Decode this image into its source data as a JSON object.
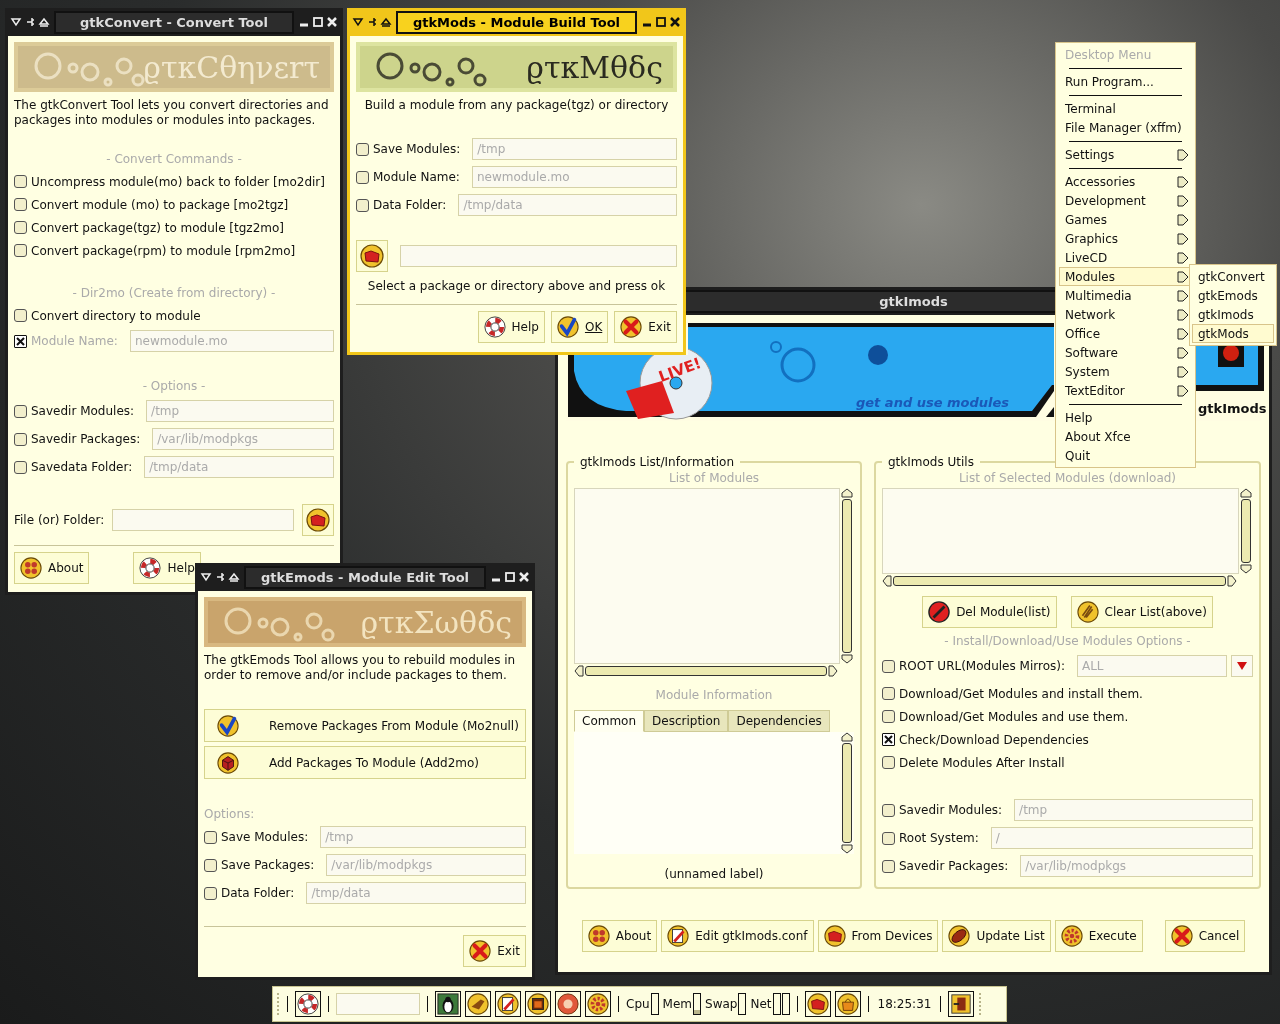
{
  "convert_window": {
    "title": "gtkConvert - Convert Tool",
    "active": false,
    "logo": "ϱτκCθηνεrτ",
    "description": "The gtkConvert Tool lets you convert directories and packages into modules or modules into packages.",
    "sections": [
      {
        "heading": "- Convert Commands -",
        "rows": [
          {
            "kind": "check",
            "label": "Uncompress module(mo) back to folder [mo2dir]",
            "checked": false,
            "disabled": false
          },
          {
            "kind": "check",
            "label": "Convert module (mo) to package [mo2tgz]",
            "checked": false,
            "disabled": false
          },
          {
            "kind": "check",
            "label": "Convert package(tgz) to module [tgz2mo]",
            "checked": false,
            "disabled": false
          },
          {
            "kind": "check",
            "label": "Convert package(rpm) to module [rpm2mo]",
            "checked": false,
            "disabled": false
          }
        ]
      },
      {
        "heading": "- Dir2mo (Create from directory) -",
        "rows": [
          {
            "kind": "check",
            "label": "Convert directory to module",
            "checked": false,
            "disabled": false
          },
          {
            "kind": "field",
            "label": "Module Name:",
            "checked": true,
            "disabled": true,
            "placeholder": "newmodule.mo"
          }
        ]
      },
      {
        "heading": "- Options -",
        "rows": [
          {
            "kind": "field",
            "label": "Savedir Modules:",
            "checked": false,
            "disabled": false,
            "placeholder": "/tmp"
          },
          {
            "kind": "field",
            "label": "Savedir Packages:",
            "checked": false,
            "disabled": false,
            "placeholder": "/var/lib/modpkgs"
          },
          {
            "kind": "field",
            "label": "Savedata Folder:",
            "checked": false,
            "disabled": false,
            "placeholder": "/tmp/data"
          }
        ]
      }
    ],
    "file_label": "File (or) Folder:",
    "buttons": [
      {
        "kind": "about",
        "label": "About"
      },
      {
        "kind": "help",
        "label": "Help"
      }
    ]
  },
  "mods_window": {
    "title": "gtkMods - Module Build Tool",
    "active": true,
    "logo": "ϱτκMθδς",
    "description": "Build a module from any package(tgz) or directory",
    "rows": [
      {
        "kind": "field",
        "label": "Save Modules:",
        "checked": false,
        "placeholder": "/tmp"
      },
      {
        "kind": "field",
        "label": "Module Name:",
        "checked": false,
        "placeholder": "newmodule.mo"
      },
      {
        "kind": "field",
        "label": "Data Folder:",
        "checked": false,
        "placeholder": "/tmp/data"
      }
    ],
    "status": "Select a package or directory above and press ok",
    "buttons": [
      {
        "kind": "help",
        "label": "Help"
      },
      {
        "kind": "ok",
        "label": "OK"
      },
      {
        "kind": "exit",
        "label": "Exit"
      }
    ]
  },
  "desktop_menu": {
    "items": [
      {
        "kind": "header",
        "label": "Desktop Menu"
      },
      {
        "kind": "separator"
      },
      {
        "kind": "item",
        "label": "Run Program...",
        "selected": false
      },
      {
        "kind": "separator"
      },
      {
        "kind": "item",
        "label": "Terminal",
        "selected": false
      },
      {
        "kind": "item",
        "label": "File Manager (xffm)",
        "selected": false
      },
      {
        "kind": "separator"
      },
      {
        "kind": "submenu",
        "label": "Settings",
        "selected": false
      },
      {
        "kind": "separator"
      },
      {
        "kind": "submenu",
        "label": "Accessories",
        "selected": false
      },
      {
        "kind": "submenu",
        "label": "Development",
        "selected": false
      },
      {
        "kind": "submenu",
        "label": "Games",
        "selected": false
      },
      {
        "kind": "submenu",
        "label": "Graphics",
        "selected": false
      },
      {
        "kind": "submenu",
        "label": "LiveCD",
        "selected": false
      },
      {
        "kind": "submenu",
        "label": "Modules",
        "selected": true,
        "items": [
          {
            "label": "gtkConvert",
            "selected": false
          },
          {
            "label": "gtkEmods",
            "selected": false
          },
          {
            "label": "gtkImods",
            "selected": false
          },
          {
            "label": "gtkMods",
            "selected": true
          }
        ]
      },
      {
        "kind": "submenu",
        "label": "Multimedia",
        "selected": false
      },
      {
        "kind": "submenu",
        "label": "Network",
        "selected": false
      },
      {
        "kind": "submenu",
        "label": "Office",
        "selected": false
      },
      {
        "kind": "submenu",
        "label": "Software",
        "selected": false
      },
      {
        "kind": "submenu",
        "label": "System",
        "selected": false
      },
      {
        "kind": "submenu",
        "label": "TextEditor",
        "selected": false
      },
      {
        "kind": "separator"
      },
      {
        "kind": "item",
        "label": "Help",
        "selected": false
      },
      {
        "kind": "item",
        "label": "About Xfce",
        "selected": false
      },
      {
        "kind": "item",
        "label": "Quit",
        "selected": false
      }
    ]
  },
  "imods_window": {
    "title": "gtkImods",
    "active": false,
    "banner": {
      "badge": "LIVE!",
      "tagline": "get and use modules",
      "logo": "gtkImods"
    },
    "list_panel": {
      "title": "gtkImods List/Information",
      "list_heading": "List of Modules",
      "info_heading": "Module Information",
      "tabs": [
        {
          "label": "Common",
          "selected": true
        },
        {
          "label": "Description",
          "selected": false
        },
        {
          "label": "Dependencies",
          "selected": false
        }
      ],
      "footer": "(unnamed label)"
    },
    "utils_panel": {
      "title": "gtkImods Utils",
      "list_heading": "List of Selected Modules (download)",
      "buttons": [
        {
          "kind": "delete",
          "label": "Del Module(list)"
        },
        {
          "kind": "clear",
          "label": "Clear List(above)"
        }
      ],
      "options_heading": "- Install/Download/Use Modules Options -",
      "rows": [
        {
          "kind": "combo",
          "label": "ROOT URL(Modules Mirros):",
          "checked": false,
          "placeholder": "ALL"
        },
        {
          "kind": "check",
          "label": "Download/Get Modules and install them.",
          "checked": false
        },
        {
          "kind": "check",
          "label": "Download/Get Modules and use them.",
          "checked": false
        },
        {
          "kind": "check",
          "label": "Check/Download Dependencies",
          "checked": true
        },
        {
          "kind": "check",
          "label": "Delete Modules After Install",
          "checked": false
        },
        {
          "kind": "field",
          "label": "Savedir Modules:",
          "checked": false,
          "placeholder": "/tmp"
        },
        {
          "kind": "field",
          "label": "Root System:",
          "checked": false,
          "placeholder": "/"
        },
        {
          "kind": "field",
          "label": "Savedir Packages:",
          "checked": false,
          "placeholder": "/var/lib/modpkgs"
        }
      ]
    },
    "buttons": [
      {
        "kind": "about",
        "label": "About"
      },
      {
        "kind": "edit",
        "label": "Edit gtkImods.conf"
      },
      {
        "kind": "devices",
        "label": "From Devices"
      },
      {
        "kind": "update",
        "label": "Update List"
      },
      {
        "kind": "execute",
        "label": "Execute"
      },
      {
        "kind": "exit",
        "label": "Cancel"
      }
    ]
  },
  "emods_window": {
    "title": "gtkEmods - Module Edit Tool",
    "active": false,
    "logo": "ϱτκΣωθδς",
    "description": "The gtkEmods Tool allows you to rebuild modules in order to remove and/or include packages to them.",
    "actions": [
      {
        "kind": "ok",
        "label": "Remove Packages From Module (Mo2null)"
      },
      {
        "kind": "add",
        "label": "Add Packages To Module (Add2mo)"
      }
    ],
    "options_heading": "Options:",
    "rows": [
      {
        "kind": "field",
        "label": "Save Modules:",
        "checked": false,
        "placeholder": "/tmp"
      },
      {
        "kind": "field",
        "label": "Save Packages:",
        "checked": false,
        "placeholder": "/var/lib/modpkgs"
      },
      {
        "kind": "field",
        "label": "Data Folder:",
        "checked": false,
        "placeholder": "/tmp/data"
      }
    ],
    "buttons": [
      {
        "kind": "exit",
        "label": "Exit"
      }
    ]
  },
  "taskbar": {
    "items": [
      {
        "kind": "handle"
      },
      {
        "kind": "separator"
      },
      {
        "kind": "launcher"
      },
      {
        "kind": "separator"
      },
      {
        "kind": "field"
      },
      {
        "kind": "separator"
      },
      {
        "kind": "launcher"
      },
      {
        "kind": "launcher"
      },
      {
        "kind": "launcher"
      },
      {
        "kind": "launcher"
      },
      {
        "kind": "launcher"
      },
      {
        "kind": "launcher"
      },
      {
        "kind": "separator"
      },
      {
        "kind": "monitor",
        "label": "Cpu",
        "bars": [
          {
            "level": 0
          }
        ]
      },
      {
        "kind": "monitor",
        "label": "Mem",
        "bars": [
          {
            "level": 0.2
          }
        ]
      },
      {
        "kind": "monitor",
        "label": "Swap",
        "bars": [
          {
            "level": 0
          }
        ]
      },
      {
        "kind": "monitor",
        "label": "Net",
        "bars": [
          {
            "level": 0
          },
          {
            "level": 0
          }
        ]
      },
      {
        "kind": "separator"
      },
      {
        "kind": "launcher"
      },
      {
        "kind": "launcher"
      },
      {
        "kind": "separator"
      },
      {
        "kind": "clock",
        "label": "18:25:31"
      },
      {
        "kind": "separator"
      },
      {
        "kind": "launcher"
      },
      {
        "kind": "handle"
      }
    ]
  }
}
